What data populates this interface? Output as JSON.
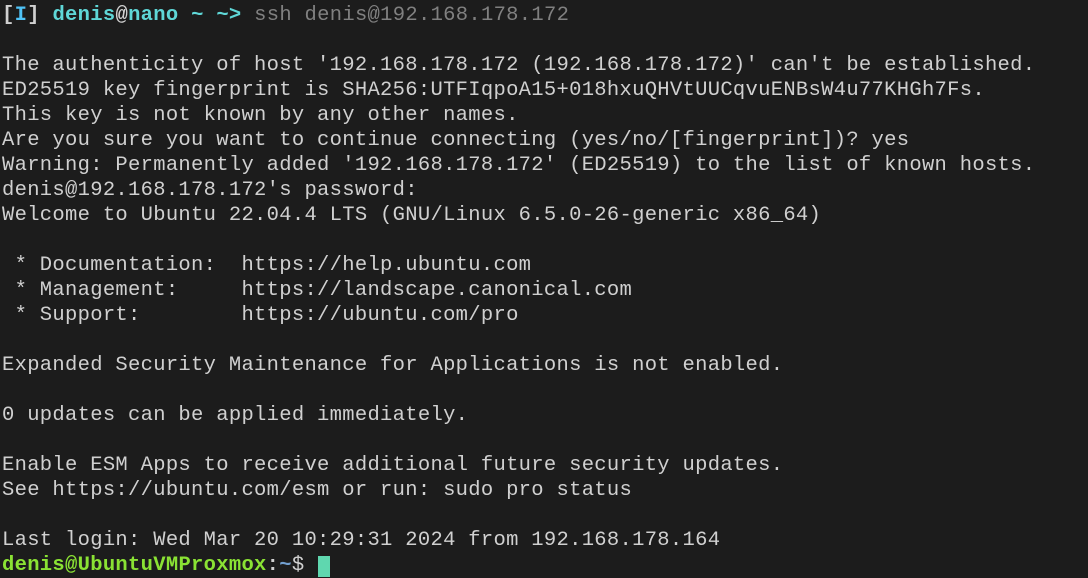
{
  "prompt1": {
    "bracket_open": "[",
    "mode": "I",
    "bracket_close": "]",
    "user": "denis",
    "at": "@",
    "host": "nano",
    "path": "~",
    "arrow": "~>",
    "command": "ssh denis@192.168.178.172"
  },
  "output": {
    "l1": "The authenticity of host '192.168.178.172 (192.168.178.172)' can't be established.",
    "l2": "ED25519 key fingerprint is SHA256:UTFIqpoA15+018hxuQHVtUUCqvuENBsW4u77KHGh7Fs.",
    "l3": "This key is not known by any other names.",
    "l4": "Are you sure you want to continue connecting (yes/no/[fingerprint])? yes",
    "l5": "Warning: Permanently added '192.168.178.172' (ED25519) to the list of known hosts.",
    "l6": "denis@192.168.178.172's password:",
    "l7": "Welcome to Ubuntu 22.04.4 LTS (GNU/Linux 6.5.0-26-generic x86_64)",
    "l8": "",
    "l9": " * Documentation:  https://help.ubuntu.com",
    "l10": " * Management:     https://landscape.canonical.com",
    "l11": " * Support:        https://ubuntu.com/pro",
    "l12": "",
    "l13": "Expanded Security Maintenance for Applications is not enabled.",
    "l14": "",
    "l15": "0 updates can be applied immediately.",
    "l16": "",
    "l17": "Enable ESM Apps to receive additional future security updates.",
    "l18": "See https://ubuntu.com/esm or run: sudo pro status",
    "l19": "",
    "l20": "Last login: Wed Mar 20 10:29:31 2024 from 192.168.178.164"
  },
  "prompt2": {
    "user": "denis",
    "at": "@",
    "host": "UbuntuVMProxmox",
    "colon": ":",
    "path": "~",
    "dollar": "$"
  }
}
